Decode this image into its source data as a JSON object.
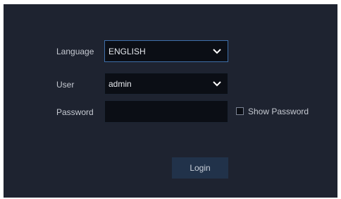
{
  "form": {
    "language": {
      "label": "Language",
      "value": "ENGLISH",
      "icon": "chevron-down-icon"
    },
    "user": {
      "label": "User",
      "value": "admin",
      "icon": "chevron-down-icon"
    },
    "password": {
      "label": "Password",
      "value": ""
    },
    "show_password": {
      "label": "Show Password",
      "checked": false
    },
    "login_button": {
      "label": "Login"
    }
  },
  "colors": {
    "panel_bg": "#1e2330",
    "field_bg": "#0b0e15",
    "focus_border": "#3e6ea8",
    "button_bg": "#21324a",
    "text": "#c5c9d1"
  }
}
